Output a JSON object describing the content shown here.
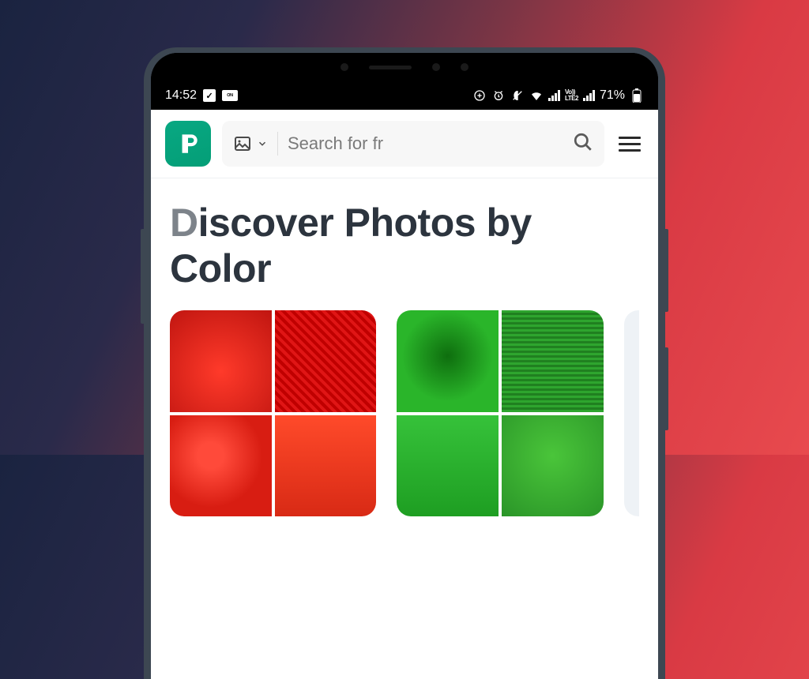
{
  "status_bar": {
    "time": "14:52",
    "battery_percent": "71%",
    "network_label": "LTE2",
    "volte_label": "Vo))"
  },
  "header": {
    "logo_letter": "P",
    "search_placeholder": "Search for fr",
    "type_label": "image"
  },
  "page": {
    "title": "Discover Photos by Color"
  },
  "color_groups": [
    {
      "name": "red"
    },
    {
      "name": "green"
    }
  ]
}
